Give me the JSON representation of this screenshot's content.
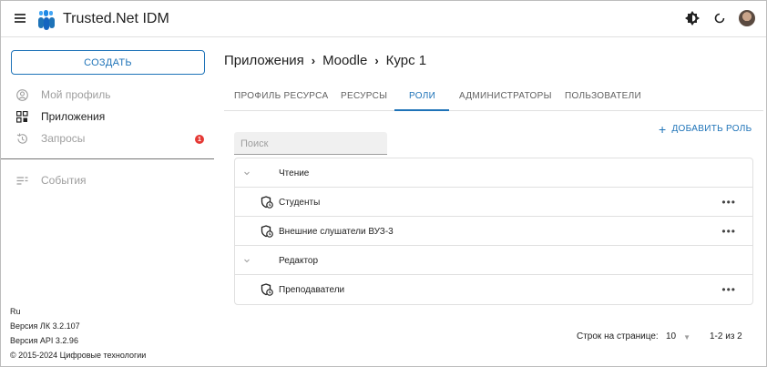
{
  "app": {
    "title": "Trusted.Net IDM",
    "menu_icon": "hamburger-menu-icon",
    "logo": "trusted-net-logo",
    "top_icons": [
      "theme-toggle-icon",
      "refresh-icon",
      "user-avatar"
    ]
  },
  "colors": {
    "accent": "#1e73b8",
    "badge": "#e53935",
    "muted": "#9e9e9e"
  },
  "sidebar": {
    "create_label": "СОЗДАТЬ",
    "items": [
      {
        "label": "Мой профиль",
        "icon": "user-circle-icon"
      },
      {
        "label": "Приложения",
        "icon": "apps-grid-icon"
      },
      {
        "label": "Запросы",
        "icon": "history-icon",
        "badge": "1"
      },
      {
        "label": "События",
        "icon": "list-icon"
      }
    ],
    "footer": {
      "lang": "Ru",
      "lk_version": "Версия ЛК 3.2.107",
      "api_version": "Версия API 3.2.96",
      "copyright": "© 2015-2024 Цифровые технологии"
    }
  },
  "breadcrumb": [
    "Приложения",
    "Moodle",
    "Курс 1"
  ],
  "tabs": [
    {
      "label": "ПРОФИЛЬ РЕСУРСА"
    },
    {
      "label": "РЕСУРСЫ"
    },
    {
      "label": "РОЛИ",
      "active": true
    },
    {
      "label": "АДМИНИСТРАТОРЫ"
    },
    {
      "label": "ПОЛЬЗОВАТЕЛИ"
    }
  ],
  "add_role_label": "ДОБАВИТЬ РОЛЬ",
  "search": {
    "placeholder": "Поиск",
    "value": ""
  },
  "roles_table": {
    "groups": [
      {
        "name": "Чтение",
        "roles": [
          "Студенты",
          "Внешние слушатели ВУЗ-3"
        ]
      },
      {
        "name": "Редактор",
        "roles": [
          "Преподаватели"
        ]
      }
    ],
    "more_label": "•••"
  },
  "pagination": {
    "rows_per_page_label": "Строк на странице:",
    "rows_per_page": "10",
    "range": "1-2 из 2"
  }
}
